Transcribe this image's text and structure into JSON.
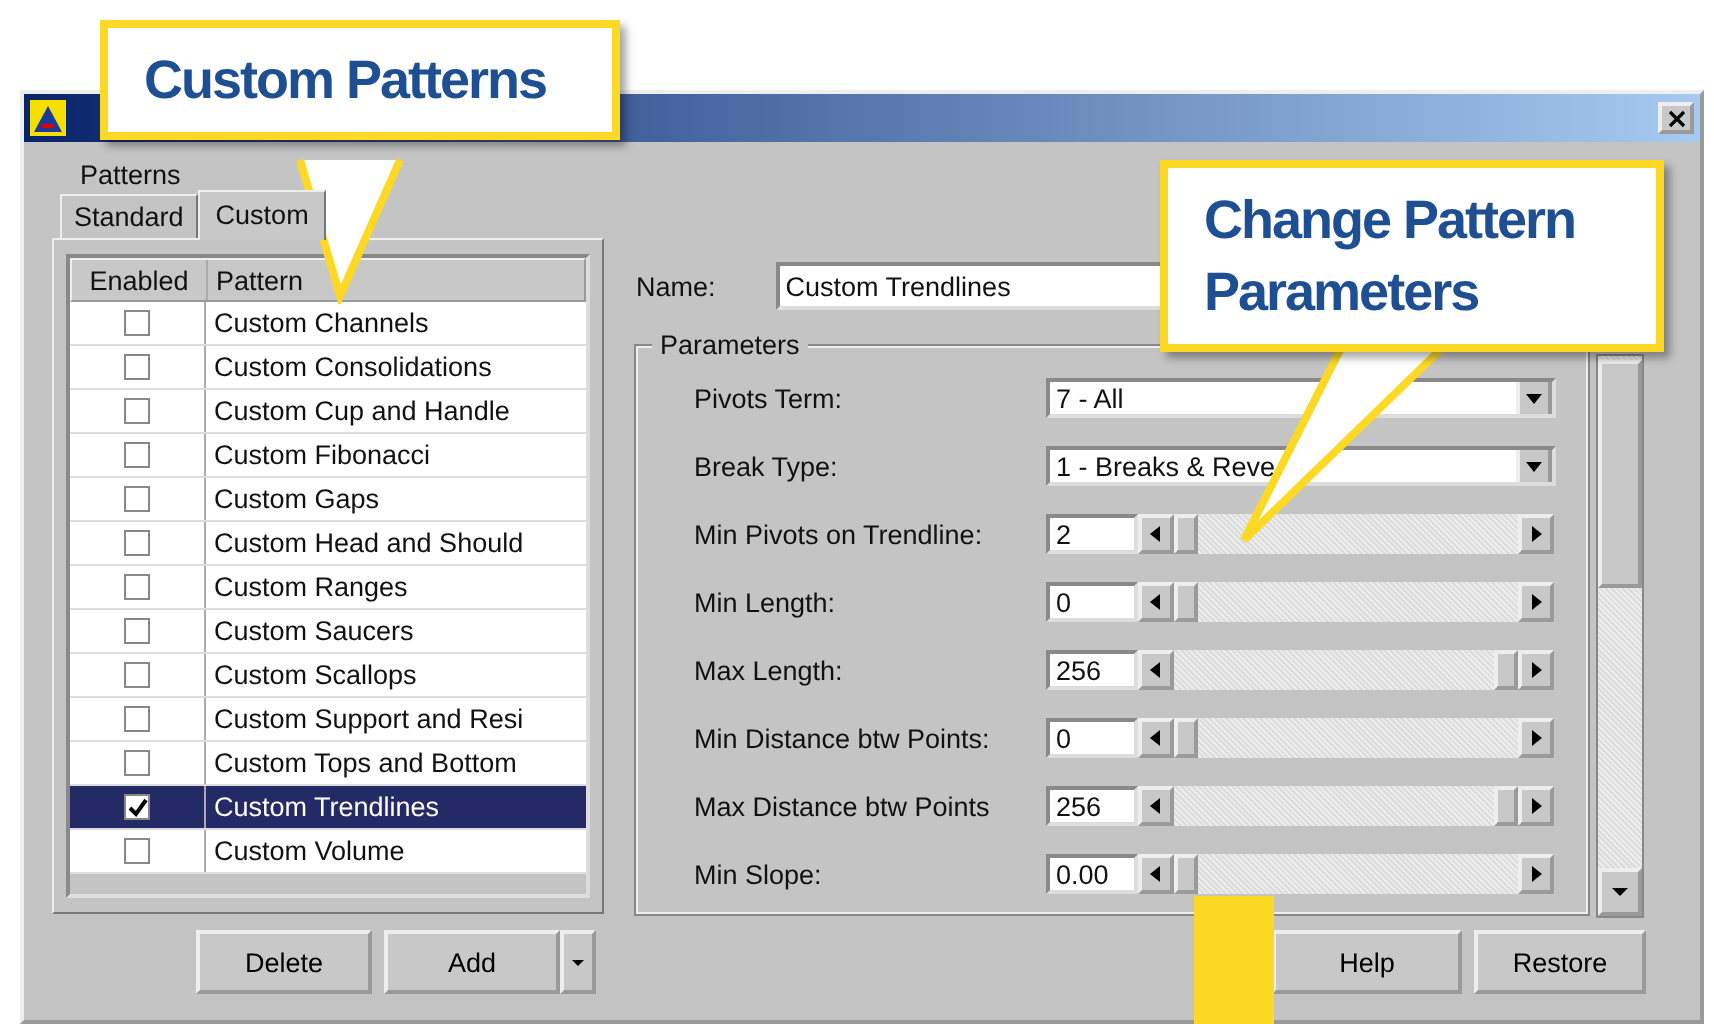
{
  "group_label": "Patterns",
  "tabs": [
    {
      "label": "Standard",
      "selected": false
    },
    {
      "label": "Custom",
      "selected": true
    }
  ],
  "pattern_list": {
    "columns": [
      "Enabled",
      "Pattern"
    ],
    "rows": [
      {
        "name": "Custom Channels",
        "enabled": false,
        "selected": false
      },
      {
        "name": "Custom Consolidations",
        "enabled": false,
        "selected": false
      },
      {
        "name": "Custom Cup and Handle",
        "enabled": false,
        "selected": false
      },
      {
        "name": "Custom Fibonacci",
        "enabled": false,
        "selected": false
      },
      {
        "name": "Custom Gaps",
        "enabled": false,
        "selected": false
      },
      {
        "name": "Custom Head and Should",
        "enabled": false,
        "selected": false
      },
      {
        "name": "Custom Ranges",
        "enabled": false,
        "selected": false
      },
      {
        "name": "Custom Saucers",
        "enabled": false,
        "selected": false
      },
      {
        "name": "Custom Scallops",
        "enabled": false,
        "selected": false
      },
      {
        "name": "Custom Support and Resi",
        "enabled": false,
        "selected": false
      },
      {
        "name": "Custom Tops and Bottom",
        "enabled": false,
        "selected": false
      },
      {
        "name": "Custom Trendlines",
        "enabled": true,
        "selected": true
      },
      {
        "name": "Custom Volume",
        "enabled": false,
        "selected": false
      }
    ]
  },
  "list_buttons": {
    "delete": "Delete",
    "add": "Add"
  },
  "name_field": {
    "label": "Name:",
    "value": "Custom Trendlines"
  },
  "parameters": {
    "label": "Parameters",
    "rows": [
      {
        "kind": "combo",
        "label": "Pivots Term:",
        "value": "7 - All"
      },
      {
        "kind": "combo",
        "label": "Break Type:",
        "value": "1 - Breaks & Reve"
      },
      {
        "kind": "slider",
        "label": "Min Pivots on Trendline:",
        "value": "2",
        "level": 0
      },
      {
        "kind": "slider",
        "label": "Min Length:",
        "value": "0",
        "level": 0
      },
      {
        "kind": "slider",
        "label": "Max Length:",
        "value": "256",
        "level": 1
      },
      {
        "kind": "slider",
        "label": "Min Distance btw Points:",
        "value": "0",
        "level": 0
      },
      {
        "kind": "slider",
        "label": "Max Distance btw Points",
        "value": "256",
        "level": 1
      },
      {
        "kind": "slider",
        "label": "Min Slope:",
        "value": "0.00",
        "level": 0
      }
    ]
  },
  "dialog_buttons": [
    "Help",
    "Restore"
  ],
  "callouts": [
    {
      "text": "Custom Patterns"
    },
    {
      "text": "Change Pattern Parameters"
    }
  ]
}
